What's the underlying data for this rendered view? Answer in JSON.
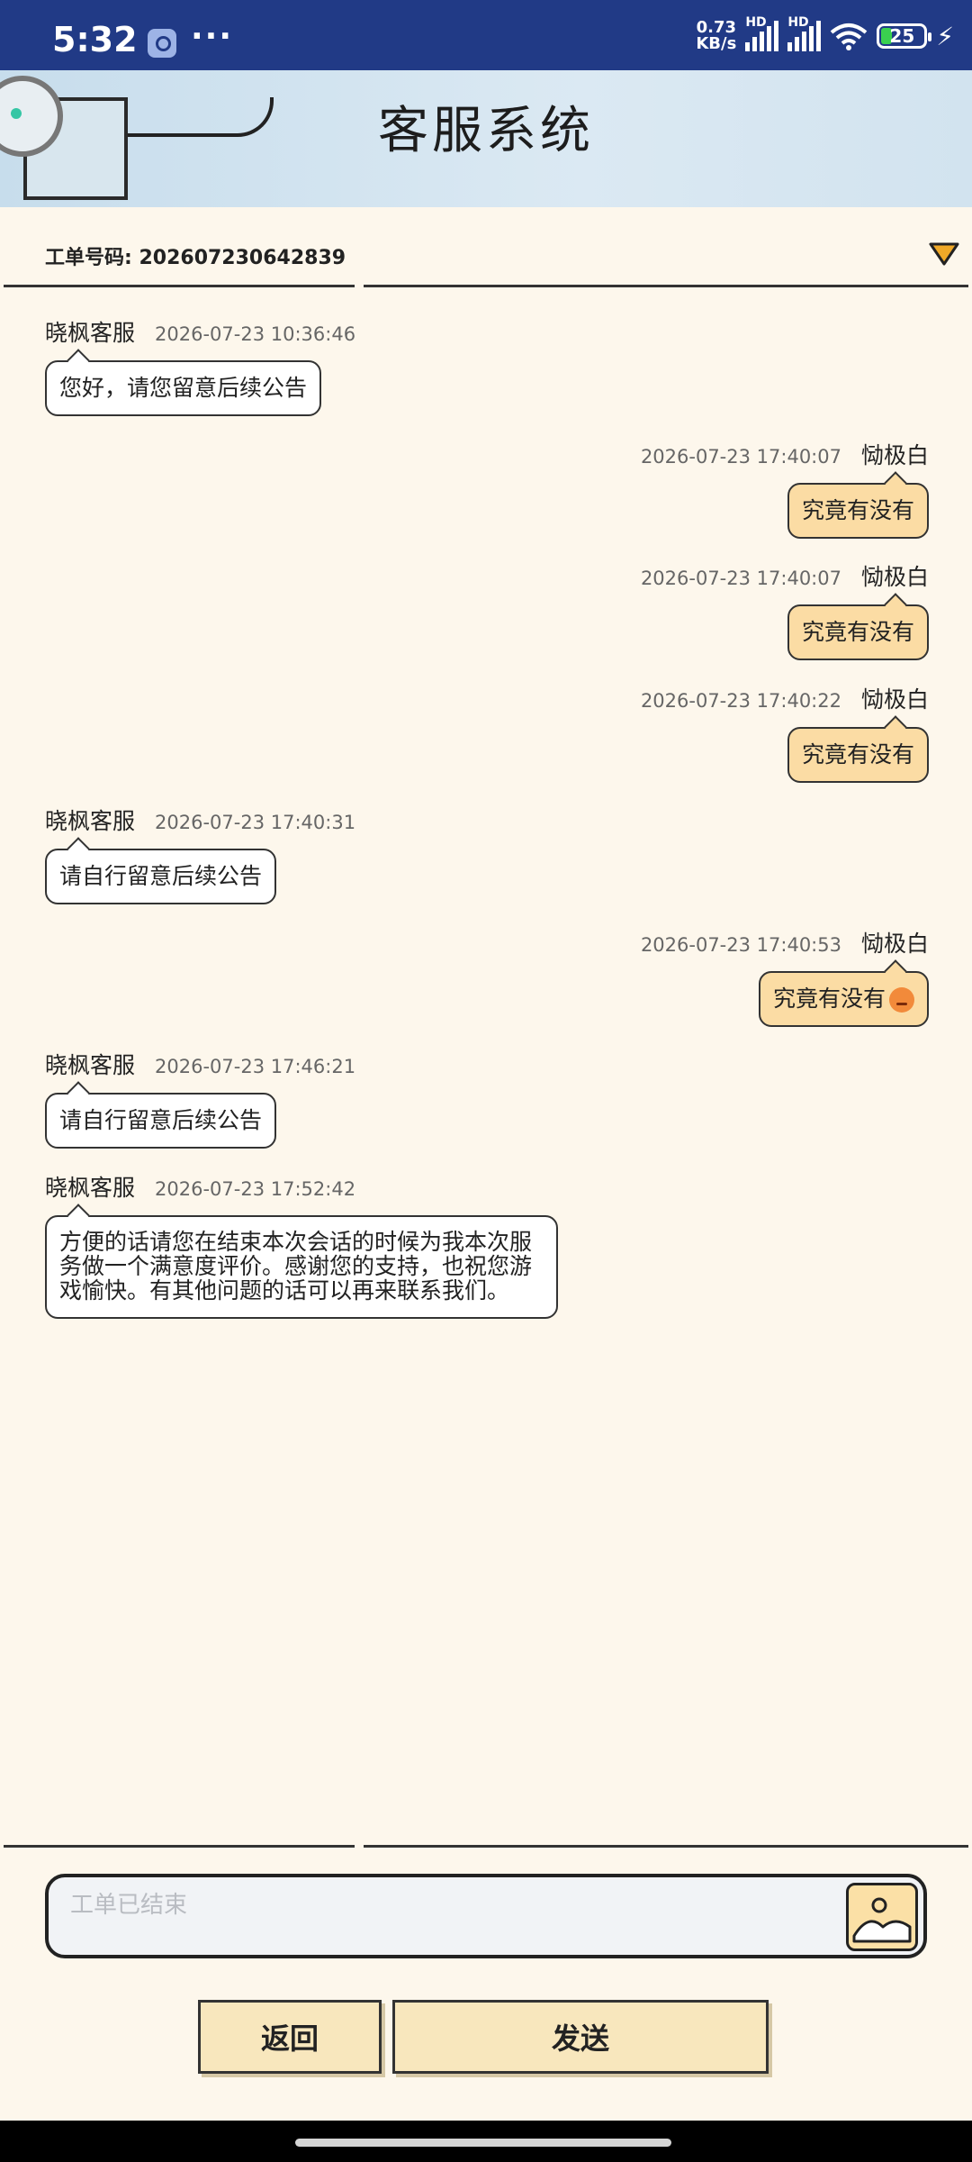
{
  "status_bar": {
    "time": "5:32",
    "dots": "···",
    "net_speed_value": "0.73",
    "net_speed_unit": "KB/s",
    "hd1": "HD",
    "hd2": "HD",
    "wifi_label": "6",
    "battery": "25",
    "battery_color": "#3ad14f",
    "background": "#213a86"
  },
  "header": {
    "title": "客服系统"
  },
  "ticket": {
    "label": "工单号码: 202607230642839",
    "toggle_icon": "triangle-down-icon",
    "accent": "#f0a928"
  },
  "messages": [
    {
      "side": "left",
      "name": "晓枫客服",
      "time": "2026-07-23 10:36:46",
      "text": "您好，请您留意后续公告"
    },
    {
      "side": "right",
      "name": "恸极白",
      "time": "2026-07-23 17:40:07",
      "text": "究竟有没有"
    },
    {
      "side": "right",
      "name": "恸极白",
      "time": "2026-07-23 17:40:07",
      "text": "究竟有没有"
    },
    {
      "side": "right",
      "name": "恸极白",
      "time": "2026-07-23 17:40:22",
      "text": "究竟有没有"
    },
    {
      "side": "left",
      "name": "晓枫客服",
      "time": "2026-07-23 17:40:31",
      "text": "请自行留意后续公告"
    },
    {
      "side": "right",
      "name": "恸极白",
      "time": "2026-07-23 17:40:53",
      "text": "究竟有没有",
      "emoji": "angry-face-icon"
    },
    {
      "side": "left",
      "name": "晓枫客服",
      "time": "2026-07-23 17:46:21",
      "text": "请自行留意后续公告"
    },
    {
      "side": "left",
      "name": "晓枫客服",
      "time": "2026-07-23 17:52:42",
      "text": "方便的话请您在结束本次会话的时候为我本次服务做一个满意度评价。感谢您的支持，也祝您游戏愉快。有其他问题的话可以再来联系我们。"
    }
  ],
  "input": {
    "placeholder": "工单已结束",
    "value": "",
    "image_icon": "image-icon"
  },
  "buttons": {
    "back": "返回",
    "send": "发送"
  },
  "colors": {
    "page_bg": "#fdf7ec",
    "user_bubble": "#fbdca4",
    "agent_bubble": "#ffffff",
    "button_bg": "#f8e7bd"
  }
}
